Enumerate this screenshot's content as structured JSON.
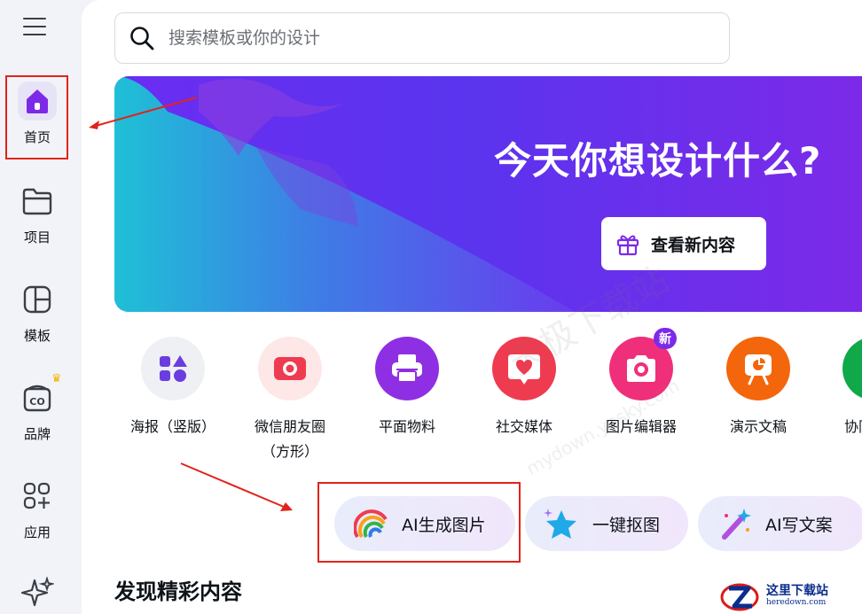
{
  "search": {
    "placeholder": "搜索模板或你的设计"
  },
  "sidebar": {
    "items": [
      {
        "label": "首页",
        "icon": "home-icon"
      },
      {
        "label": "项目",
        "icon": "folder-icon"
      },
      {
        "label": "模板",
        "icon": "template-icon"
      },
      {
        "label": "品牌",
        "icon": "brand-icon"
      },
      {
        "label": "应用",
        "icon": "apps-icon"
      },
      {
        "label": "",
        "icon": "magic-sparkle-icon"
      }
    ]
  },
  "banner": {
    "title": "今天你想设计什么?",
    "button_label": "查看新内容"
  },
  "categories": [
    {
      "label": "海报（竖版）",
      "icon": "poster-shapes-icon",
      "color": "#eef0f3"
    },
    {
      "label": "微信朋友圈\n（方形）",
      "icon": "camera-shutter-icon",
      "color": "#fde7e7"
    },
    {
      "label": "平面物料",
      "icon": "printer-icon",
      "color": "#8f2fe3"
    },
    {
      "label": "社交媒体",
      "icon": "heart-bubble-icon",
      "color": "#ef3b50"
    },
    {
      "label": "图片编辑器",
      "icon": "photo-camera-icon",
      "color": "#f02f7b",
      "badge": "新"
    },
    {
      "label": "演示文稿",
      "icon": "presentation-icon",
      "color": "#f4660b"
    },
    {
      "label": "协同",
      "icon": "collab-icon",
      "color": "#11a84a"
    }
  ],
  "chips": [
    {
      "label": "AI生成图片",
      "icon": "rainbow-icon"
    },
    {
      "label": "一键抠图",
      "icon": "star-icon"
    },
    {
      "label": "AI写文案",
      "icon": "magic-wand-icon"
    }
  ],
  "section": {
    "title": "发现精彩内容"
  },
  "watermark": {
    "text": "这里下载站",
    "sub": "heredown.com"
  },
  "overlay_watermark": {
    "line1": "天极下载站",
    "line2": "mydown.yesky.com"
  },
  "colors": {
    "accent": "#7d2ae8",
    "annotation": "#e2231a",
    "banner_start": "#6b2df2",
    "banner_wave": "#1ec0d6"
  }
}
